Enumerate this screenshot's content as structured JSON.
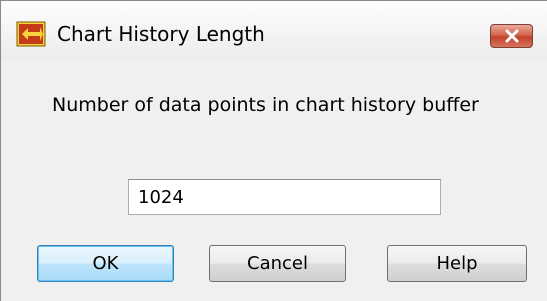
{
  "window": {
    "title": "Chart History Length",
    "icon": "labview-app-icon",
    "close_icon": "close-x-icon"
  },
  "dialog": {
    "message": "Number of data points in chart history buffer",
    "input_value": "1024"
  },
  "buttons": {
    "ok": "OK",
    "cancel": "Cancel",
    "help": "Help"
  },
  "colors": {
    "close_button": "#c2432d",
    "default_button_border": "#3c7fb1",
    "dialog_background": "#f0f0f0"
  }
}
